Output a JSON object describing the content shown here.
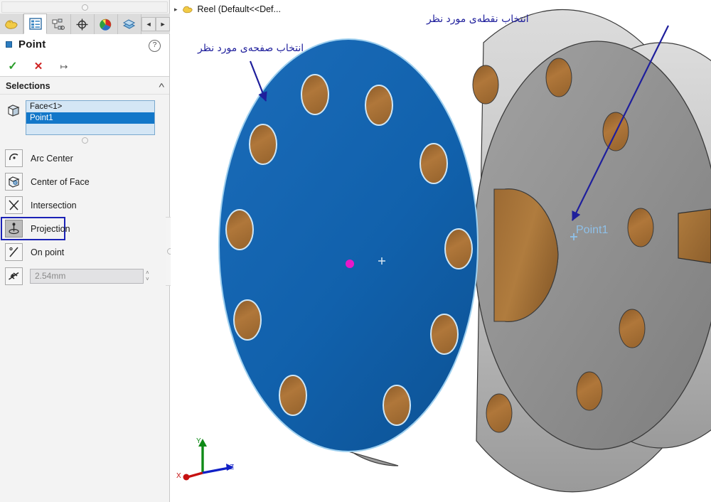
{
  "app": {
    "document_title": "Reel  (Default<<Def...",
    "doc_icon": "part-icon",
    "expand_arrow": "▸"
  },
  "property_manager": {
    "tabs": [
      {
        "name": "feature-manager-tab",
        "icon": "feature-tree-icon",
        "active": false
      },
      {
        "name": "property-manager-tab",
        "icon": "property-list-icon",
        "active": true
      },
      {
        "name": "configuration-manager-tab",
        "icon": "configuration-icon",
        "active": false
      },
      {
        "name": "dimxpert-manager-tab",
        "icon": "dimxpert-target-icon",
        "active": false
      },
      {
        "name": "display-manager-tab",
        "icon": "appearance-sphere-icon",
        "active": false
      },
      {
        "name": "render-manager-tab",
        "icon": "render-layers-icon",
        "active": false
      }
    ],
    "nav_prev": "◄",
    "nav_next": "►",
    "title": "Point",
    "help_glyph": "?",
    "actions": {
      "ok": "✓",
      "cancel": "✕",
      "pin": "↦"
    },
    "selections": {
      "header": "Selections",
      "collapse_glyph": "˄",
      "items": [
        {
          "label": "Face<1>",
          "selected": false
        },
        {
          "label": "Point1",
          "selected": true
        },
        {
          "label": "",
          "selected": false
        }
      ]
    },
    "point_types": [
      {
        "label": "Arc Center",
        "icon": "arc-center-icon",
        "selected": false
      },
      {
        "label": "Center of Face",
        "icon": "center-of-face-icon",
        "selected": false
      },
      {
        "label": "Intersection",
        "icon": "intersection-icon",
        "selected": false
      },
      {
        "label": "Projection",
        "icon": "projection-icon",
        "selected": true
      },
      {
        "label": "On point",
        "icon": "on-point-icon",
        "selected": false
      }
    ],
    "spacing": {
      "icon": "spacing-icon",
      "value": "2.54mm",
      "placeholder": "2.54mm",
      "spin_up": "˄",
      "spin_down": "˅"
    }
  },
  "viewport": {
    "annotations": [
      {
        "name": "annotation-select-point",
        "text": "انتخاب نقطه‌ی مورد نظر"
      },
      {
        "name": "annotation-select-face",
        "text": "انتخاب صفحه‌ی مورد نظر"
      }
    ],
    "point_label": "Point1",
    "triad": {
      "x": "X",
      "y": "Y",
      "z": "Z"
    }
  },
  "colors": {
    "selected_face": "#1060ac",
    "body_gray": "#8f8f8f",
    "hole_brown": "#a8703a",
    "annotation_blue": "#1f1f9c",
    "point_label_blue": "#8fc0e8",
    "origin_magenta": "#e818c8",
    "list_selected": "#1277c9",
    "option_highlight": "#1b22b6"
  }
}
